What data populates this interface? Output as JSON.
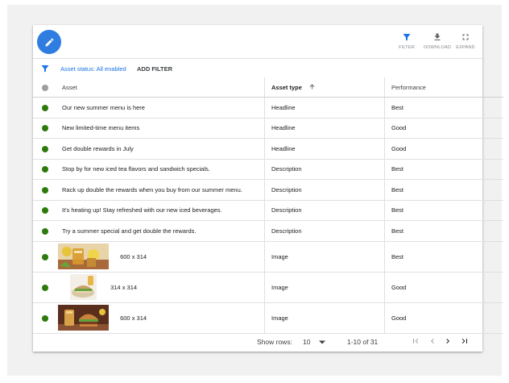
{
  "toolbar": {
    "filter_label": "FILTER",
    "download_label": "DOWNLOAD",
    "expand_label": "EXPAND"
  },
  "filter_bar": {
    "status": "Asset status: All enabled",
    "add_filter": "ADD FILTER"
  },
  "table": {
    "columns": {
      "asset": "Asset",
      "asset_type": "Asset type",
      "performance": "Performance"
    },
    "rows": [
      {
        "asset": "Our new summer menu is here",
        "type": "Headline",
        "performance": "Best"
      },
      {
        "asset": "New limited-time menu items",
        "type": "Headline",
        "performance": "Good"
      },
      {
        "asset": "Get double rewards in July",
        "type": "Headline",
        "performance": "Good"
      },
      {
        "asset": "Stop by for new iced tea flavors and sandwich specials.",
        "type": "Description",
        "performance": "Best"
      },
      {
        "asset": "Rack up double the rewards when you buy from our summer menu.",
        "type": "Description",
        "performance": "Best"
      },
      {
        "asset": "It's heating up! Stay refreshed with our new iced beverages.",
        "type": "Description",
        "performance": "Best"
      },
      {
        "asset": "Try a summer special and get double the rewards.",
        "type": "Description",
        "performance": "Best"
      }
    ],
    "image_rows": [
      {
        "dimensions": "600 x 314",
        "type": "Image",
        "performance": "Best",
        "thumb_icon": "iced-tea-image"
      },
      {
        "dimensions": "314 x 314",
        "type": "Image",
        "performance": "Good",
        "thumb_icon": "sandwich-image"
      },
      {
        "dimensions": "600 x 314",
        "type": "Image",
        "performance": "Good",
        "thumb_icon": "burger-drink-image"
      }
    ]
  },
  "footer": {
    "show_rows_label": "Show rows:",
    "rows_value": "10",
    "range": "1-10 of 31"
  },
  "colors": {
    "accent": "#2f7de1",
    "status_enabled": "#2b7a0b",
    "link": "#1a73e8"
  }
}
